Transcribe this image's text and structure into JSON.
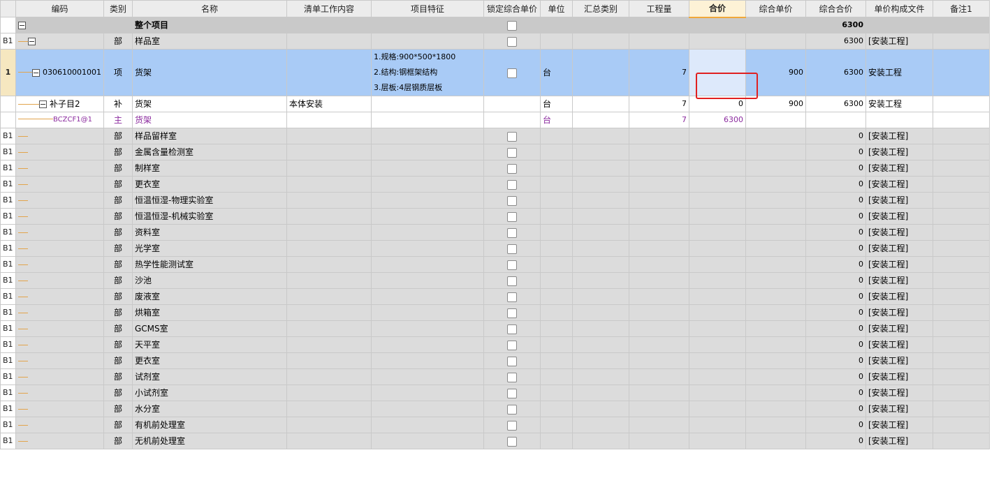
{
  "columns": [
    "",
    "编码",
    "类别",
    "名称",
    "清单工作内容",
    "项目特征",
    "锁定综合单价",
    "单位",
    "汇总类别",
    "工程量",
    "合价",
    "综合单价",
    "综合合价",
    "单价构成文件",
    "备注1"
  ],
  "active_column": "合价",
  "root": {
    "name": "整个项目",
    "total": "6300"
  },
  "part_row": {
    "rh": "B1",
    "type": "部",
    "name": "样品室",
    "total": "6300",
    "file": "[安装工程]"
  },
  "item_row": {
    "rh": "1",
    "code": "030610001001",
    "type": "项",
    "name": "货架",
    "features": [
      "1.规格:900*500*1800",
      "2.结构:钢框架结构",
      "3.层板:4层钢质层板"
    ],
    "unit": "台",
    "qty": "7",
    "hejia": "",
    "unit_price": "900",
    "total": "6300",
    "file": "安装工程"
  },
  "sub_row": {
    "code": "补子目2",
    "type": "补",
    "name": "货架",
    "work": "本体安装",
    "unit": "台",
    "qty": "7",
    "hejia": "0",
    "unit_price": "900",
    "total": "6300",
    "file": "安装工程"
  },
  "main_row": {
    "code": "BCZCF1@1",
    "type": "主",
    "name": "货架",
    "unit": "台",
    "qty": "7",
    "hejia": "6300"
  },
  "sections": [
    {
      "rh": "B1",
      "type": "部",
      "name": "样品留样室",
      "total": "0",
      "file": "[安装工程]"
    },
    {
      "rh": "B1",
      "type": "部",
      "name": "金属含量检测室",
      "total": "0",
      "file": "[安装工程]"
    },
    {
      "rh": "B1",
      "type": "部",
      "name": "制样室",
      "total": "0",
      "file": "[安装工程]"
    },
    {
      "rh": "B1",
      "type": "部",
      "name": "更衣室",
      "total": "0",
      "file": "[安装工程]"
    },
    {
      "rh": "B1",
      "type": "部",
      "name": "恒温恒湿-物理实验室",
      "total": "0",
      "file": "[安装工程]"
    },
    {
      "rh": "B1",
      "type": "部",
      "name": "恒温恒湿-机械实验室",
      "total": "0",
      "file": "[安装工程]"
    },
    {
      "rh": "B1",
      "type": "部",
      "name": "资料室",
      "total": "0",
      "file": "[安装工程]"
    },
    {
      "rh": "B1",
      "type": "部",
      "name": "光学室",
      "total": "0",
      "file": "[安装工程]"
    },
    {
      "rh": "B1",
      "type": "部",
      "name": "热学性能测试室",
      "total": "0",
      "file": "[安装工程]"
    },
    {
      "rh": "B1",
      "type": "部",
      "name": "沙池",
      "total": "0",
      "file": "[安装工程]"
    },
    {
      "rh": "B1",
      "type": "部",
      "name": "废液室",
      "total": "0",
      "file": "[安装工程]"
    },
    {
      "rh": "B1",
      "type": "部",
      "name": "烘箱室",
      "total": "0",
      "file": "[安装工程]"
    },
    {
      "rh": "B1",
      "type": "部",
      "name": "GCMS室",
      "total": "0",
      "file": "[安装工程]"
    },
    {
      "rh": "B1",
      "type": "部",
      "name": "天平室",
      "total": "0",
      "file": "[安装工程]"
    },
    {
      "rh": "B1",
      "type": "部",
      "name": "更衣室",
      "total": "0",
      "file": "[安装工程]"
    },
    {
      "rh": "B1",
      "type": "部",
      "name": "试剂室",
      "total": "0",
      "file": "[安装工程]"
    },
    {
      "rh": "B1",
      "type": "部",
      "name": "小试剂室",
      "total": "0",
      "file": "[安装工程]"
    },
    {
      "rh": "B1",
      "type": "部",
      "name": "水分室",
      "total": "0",
      "file": "[安装工程]"
    },
    {
      "rh": "B1",
      "type": "部",
      "name": "有机前处理室",
      "total": "0",
      "file": "[安装工程]"
    },
    {
      "rh": "B1",
      "type": "部",
      "name": "无机前处理室",
      "total": "0",
      "file": "[安装工程]"
    }
  ],
  "colors": {
    "selected_row": "#a9cbf6",
    "highlight_box": "#e02020",
    "purple_text": "#8b2a9e",
    "header_active": "#fdf2d6"
  }
}
